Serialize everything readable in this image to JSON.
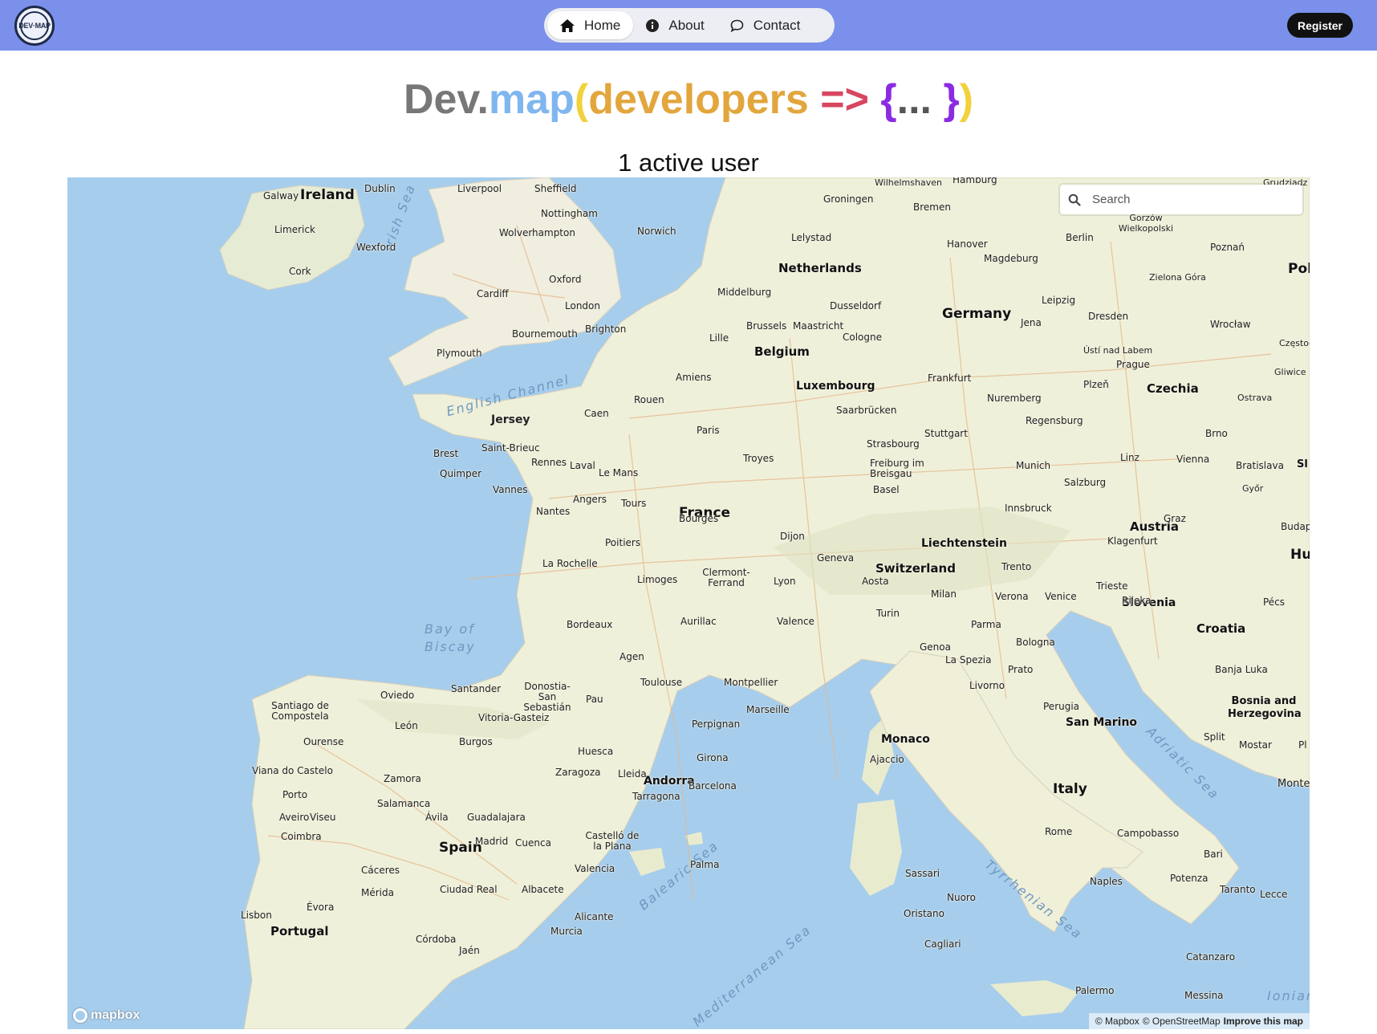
{
  "nav": {
    "logo_text": "DEV·MAP",
    "items": [
      {
        "label": "Home",
        "icon": "home-icon",
        "active": true
      },
      {
        "label": "About",
        "icon": "info-icon",
        "active": false
      },
      {
        "label": "Contact",
        "icon": "chat-bubble-icon",
        "active": false
      }
    ],
    "register_label": "Register"
  },
  "title": {
    "dev": "Dev.",
    "map": "map",
    "open_paren": "(",
    "developers": "developers",
    "arrow": " => ",
    "open_brace": "{",
    "dots": "... ",
    "close_brace": "}",
    "close_paren": ")"
  },
  "active_users": "1 active user",
  "map": {
    "search_placeholder": "Search",
    "mapbox_logo": "mapbox",
    "attribution": {
      "mapbox": "© Mapbox",
      "osm": "© OpenStreetMap",
      "improve": "Improve this map"
    },
    "countries": [
      "Ireland",
      "Netherlands",
      "Germany",
      "Belgium",
      "Luxembourg",
      "Czechia",
      "France",
      "Liechtenstein",
      "Switzerland",
      "Austria",
      "Slovenia",
      "Croatia",
      "Italy",
      "Spain",
      "Portugal",
      "Andorra",
      "Monaco",
      "San Marino",
      "Bosnia and Herzegovina"
    ],
    "cities": [
      "Galway",
      "Dublin",
      "Limerick",
      "Wexford",
      "Cork",
      "Liverpool",
      "Sheffield",
      "Nottingham",
      "Wolverhampton",
      "Norwich",
      "Oxford",
      "Cardiff",
      "London",
      "Bournemouth",
      "Brighton",
      "Plymouth",
      "Jersey",
      "Groningen",
      "Bremen",
      "Hamburg",
      "Berlin",
      "Hanover",
      "Magdeburg",
      "Leipzig",
      "Dresden",
      "Jena",
      "Lelystad",
      "Middelburg",
      "Dusseldorf",
      "Cologne",
      "Brussels",
      "Maastricht",
      "Lille",
      "Frankfurt",
      "Prague",
      "Plzeň",
      "Nuremberg",
      "Amiens",
      "Rouen",
      "Caen",
      "Paris",
      "Saarbrücken",
      "Strasbourg",
      "Stuttgart",
      "Regensburg",
      "Brest",
      "Saint-Brieuc",
      "Rennes",
      "Quimper",
      "Laval",
      "Le Mans",
      "Vannes",
      "Nantes",
      "Angers",
      "Tours",
      "Troyes",
      "Dijon",
      "Freiburg im Breisgau",
      "Munich",
      "Linz",
      "Vienna",
      "Bratislava",
      "Salzburg",
      "Basel",
      "Innsbruck",
      "Graz",
      "Klagenfurt",
      "Bourges",
      "Poitiers",
      "La Rochelle",
      "Limoges",
      "Clermont-Ferrand",
      "Geneva",
      "Aosta",
      "Trento",
      "Trieste",
      "Rijeka",
      "Lyon",
      "Milan",
      "Verona",
      "Venice",
      "Bordeaux",
      "Aurillac",
      "Valence",
      "Turin",
      "Parma",
      "Bologna",
      "Genoa",
      "La Spezia",
      "Agen",
      "Toulouse",
      "Montpellier",
      "Marseille",
      "Livorno",
      "Prato",
      "Santander",
      "Donostia-San Sebastián",
      "Pau",
      "Oviedo",
      "Santiago de Compostela",
      "Vitoria-Gasteiz",
      "León",
      "Ourense",
      "Burgos",
      "Huesca",
      "Perpignan",
      "Girona",
      "Perugia",
      "Ajaccio",
      "Viana do Castelo",
      "Zamora",
      "Zaragoza",
      "Lleida",
      "Barcelona",
      "Tarragona",
      "Porto",
      "Salamanca",
      "Aveiro",
      "Viseu",
      "Ávila",
      "Guadalajara",
      "Coimbra",
      "Madrid",
      "Cuenca",
      "Castelló de la Plana",
      "Valencia",
      "Palma",
      "Cáceres",
      "Mérida",
      "Ciudad Real",
      "Albacete",
      "Lisbon",
      "Évora",
      "Alicante",
      "Murcia",
      "Córdoba",
      "Jaén",
      "Sassari",
      "Nuoro",
      "Oristano",
      "Cagliari",
      "Rome",
      "Campobasso",
      "Bari",
      "Naples",
      "Potenza",
      "Taranto",
      "Lecce",
      "Catanzaro",
      "Palermo",
      "Messina",
      "Split",
      "Mostar",
      "Banja Luka",
      "Pécs",
      "Gorzów Wielkopolski",
      "Poznań",
      "Zielona Góra",
      "Wrocław",
      "Ústí nad Labem",
      "Ostrava",
      "Brno",
      "Győr",
      "Wilhelmshaven",
      "Grudziądz",
      "Częstochowa",
      "Gliwice"
    ],
    "seas": [
      "Irish Sea",
      "English Channel",
      "Bay of Biscay",
      "Balearic Sea",
      "Mediterranean Sea",
      "Tyrrhenian Sea",
      "Adriatic Sea",
      "Ionian"
    ],
    "edge_labels": [
      "Pol",
      "Hu",
      "Sl",
      "Budap",
      "Monte",
      "Pl"
    ],
    "colors": {
      "water": "#a6cdec",
      "land": "#f2f0e4",
      "road": "#e8b88a",
      "nav_bg": "#7a90ea"
    }
  }
}
